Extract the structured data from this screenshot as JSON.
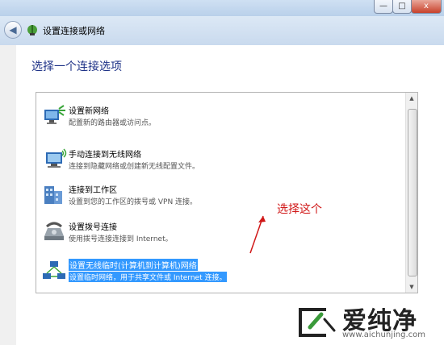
{
  "window": {
    "title": "设置连接或网络",
    "controls": {
      "minimize": "—",
      "maximize": "□",
      "close": "x"
    },
    "back_icon": "back-arrow-icon"
  },
  "page": {
    "heading": "选择一个连接选项"
  },
  "options": [
    {
      "title": "设置新网络",
      "description": "配置新的路由器或访问点。",
      "icon": "network-router-icon"
    },
    {
      "title": "手动连接到无线网络",
      "description": "连接到隐藏网络或创建新无线配置文件。",
      "icon": "wireless-computer-icon"
    },
    {
      "title": "连接到工作区",
      "description": "设置到您的工作区的拨号或 VPN 连接。",
      "icon": "workplace-building-icon"
    },
    {
      "title": "设置拨号连接",
      "description": "使用拨号连接连接到 Internet。",
      "icon": "dialup-phone-icon"
    },
    {
      "title": "设置无线临时(计算机到计算机)网络",
      "description": "设置临时网络，用于共享文件或 Internet 连接。",
      "icon": "adhoc-network-icon",
      "selected": true
    }
  ],
  "annotation": {
    "text": "选择这个",
    "color": "#d01818"
  },
  "watermark": {
    "text": "爱纯净",
    "url": "www.aichunjing.com"
  },
  "colors": {
    "heading": "#1e3287",
    "selection": "#3399ff",
    "highlight_box": "#e02020"
  }
}
